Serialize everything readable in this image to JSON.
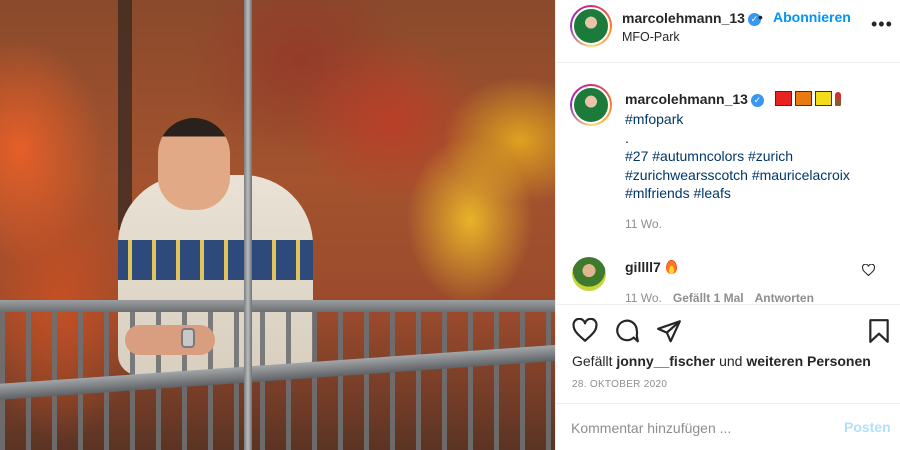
{
  "post": {
    "username": "marcolehmann_13",
    "follow_separator": "•",
    "follow_label": "Abonnieren",
    "location": "MFO-Park",
    "more_label": "•••",
    "verified_glyph": "✓",
    "flag_colors": [
      "#e8231f",
      "#e97a12",
      "#f4dc1a"
    ]
  },
  "caption": {
    "username": "marcolehmann_13",
    "lines": [
      "#mfopark",
      ".",
      "#27 #autumncolors #zurich",
      "#zurichwearsscotch #mauricelacroix",
      "#mlfriends #leafs"
    ],
    "time": "11 Wo."
  },
  "comment": {
    "username": "gillll7",
    "time": "11 Wo.",
    "likes": "Gefällt 1 Mal",
    "reply": "Antworten"
  },
  "actions": {
    "icons": [
      "heart-icon",
      "comment-icon",
      "share-icon",
      "bookmark-icon"
    ],
    "likes_prefix": "Gefällt",
    "likes_user": "jonny__fischer",
    "likes_mid": "und",
    "likes_rest": "weiteren Personen",
    "date": "28. Oktober 2020"
  },
  "add_comment": {
    "placeholder": "Kommentar hinzufügen ...",
    "post_label": "Posten"
  },
  "colors": {
    "link": "#00376b",
    "accent": "#0095f6",
    "muted": "#8e8e8e",
    "post_disabled": "#b2dffc"
  }
}
